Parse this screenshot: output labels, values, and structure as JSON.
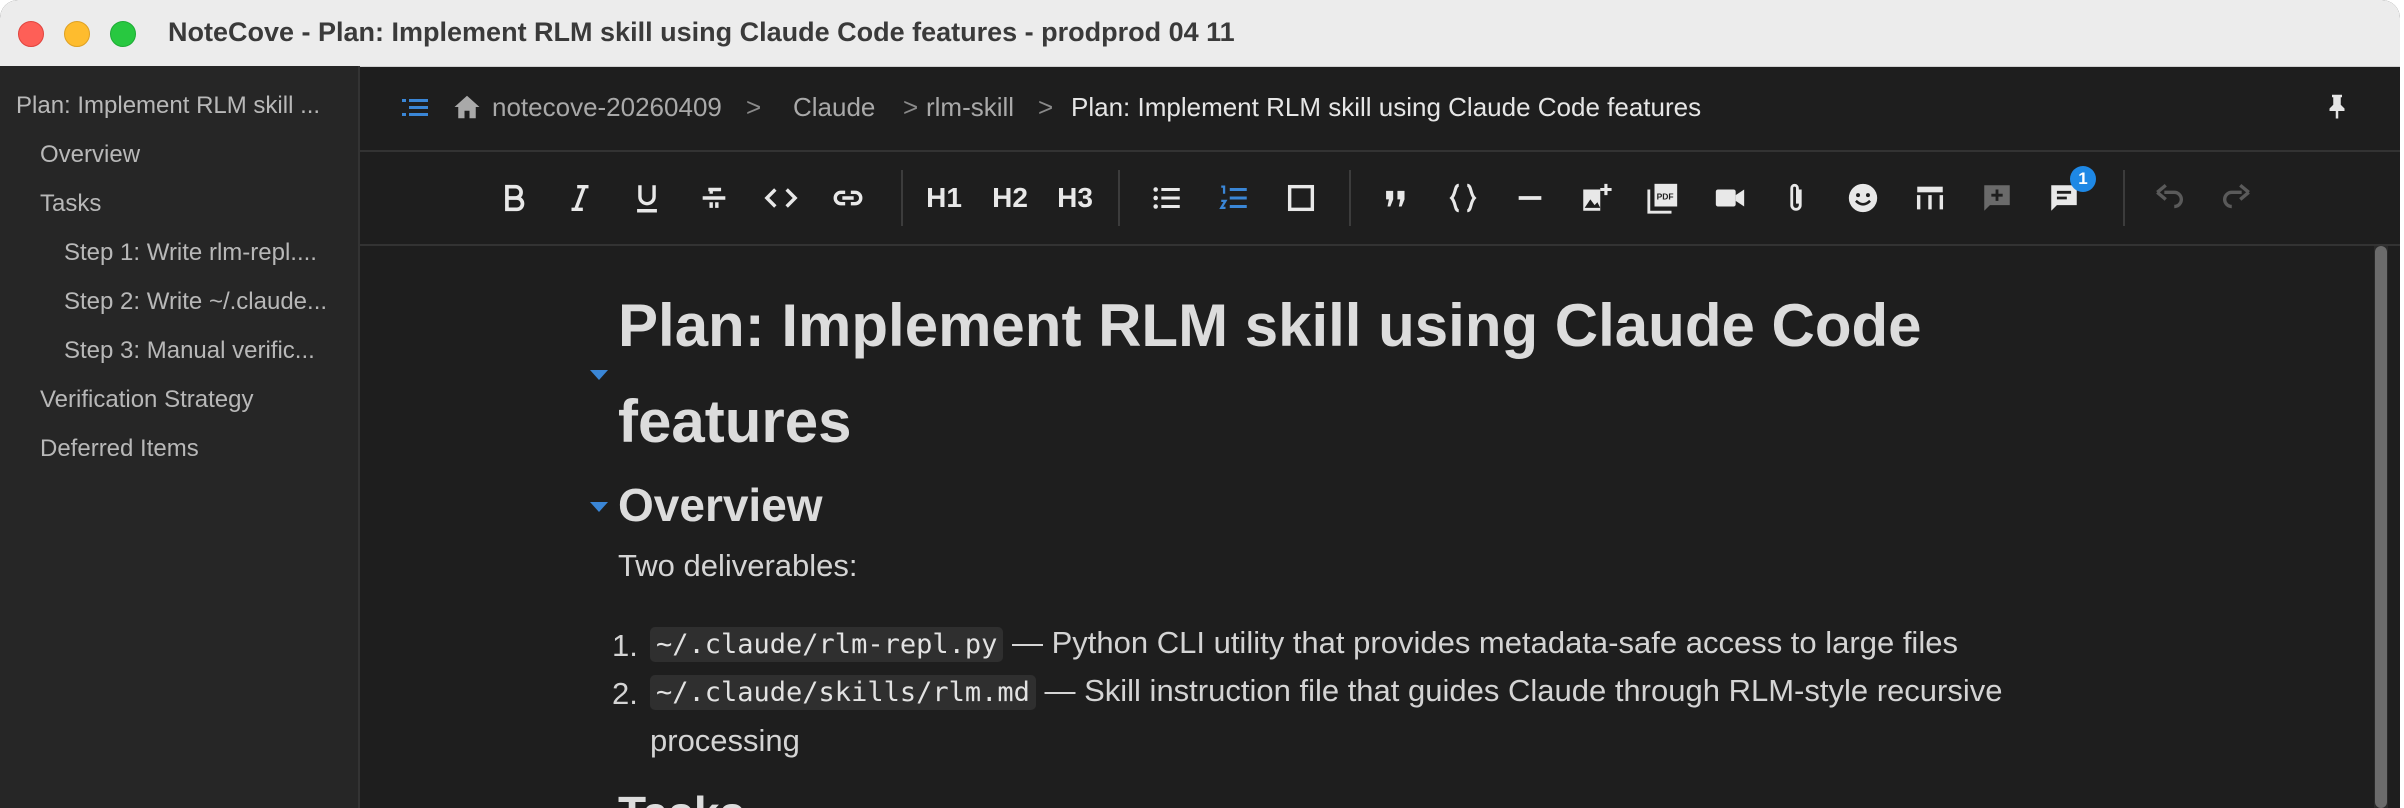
{
  "window": {
    "title": "NoteCove - Plan: Implement RLM skill using Claude Code features - prodprod 04 11"
  },
  "sidebar": {
    "items": [
      {
        "label": "Plan: Implement RLM skill ...",
        "level": 0
      },
      {
        "label": "Overview",
        "level": 1
      },
      {
        "label": "Tasks",
        "level": 1
      },
      {
        "label": "Step 1: Write rlm-repl....",
        "level": 2
      },
      {
        "label": "Step 2: Write ~/.claude...",
        "level": 2
      },
      {
        "label": "Step 3: Manual verific...",
        "level": 2
      },
      {
        "label": "Verification Strategy",
        "level": 1
      },
      {
        "label": "Deferred Items",
        "level": 1
      }
    ]
  },
  "breadcrumb": {
    "items": [
      "notecove-20260409",
      "Claude",
      "rlm-skill"
    ],
    "current": "Plan: Implement RLM skill using Claude Code features",
    "separator": ">"
  },
  "toolbar": {
    "h1": "H1",
    "h2": "H2",
    "h3": "H3",
    "comments_badge": "1",
    "accent_color": "#3a86d6"
  },
  "doc": {
    "title": "Plan: Implement RLM skill using Claude Code features",
    "overview_heading": "Overview",
    "intro": "Two deliverables:",
    "list": [
      {
        "num": "1.",
        "code": "~/.claude/rlm-repl.py",
        "text": " — Python CLI utility that provides metadata-safe access to large files",
        "cont": ""
      },
      {
        "num": "2.",
        "code": "~/.claude/skills/rlm.md",
        "text": " — Skill instruction file that guides Claude through RLM-style recursive",
        "cont": "processing"
      }
    ],
    "next_heading": "Tasks"
  }
}
